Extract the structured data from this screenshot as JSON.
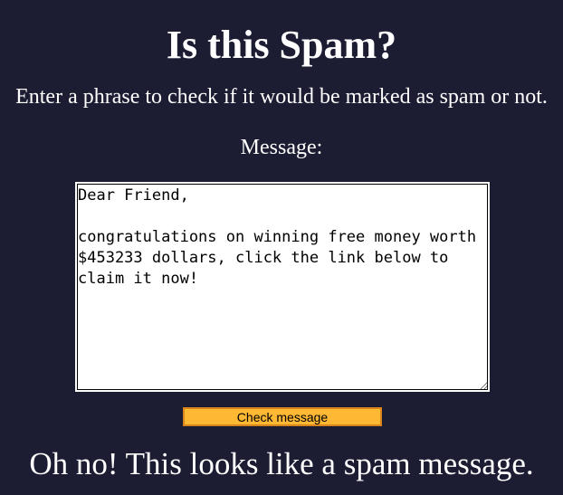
{
  "page": {
    "title": "Is this Spam?",
    "subtitle": "Enter a phrase to check if it would be marked as spam or not.",
    "background_color": "#1c1c33",
    "text_color": "#ffffff"
  },
  "form": {
    "message_label": "Message:",
    "message_value": "Dear Friend,\n\ncongratulations on winning free money worth $453233 dollars, click the link below to claim it now!",
    "check_button_label": "Check message",
    "check_button_color": "#ffb833"
  },
  "result": {
    "text": "Oh no! This looks like a spam message."
  }
}
